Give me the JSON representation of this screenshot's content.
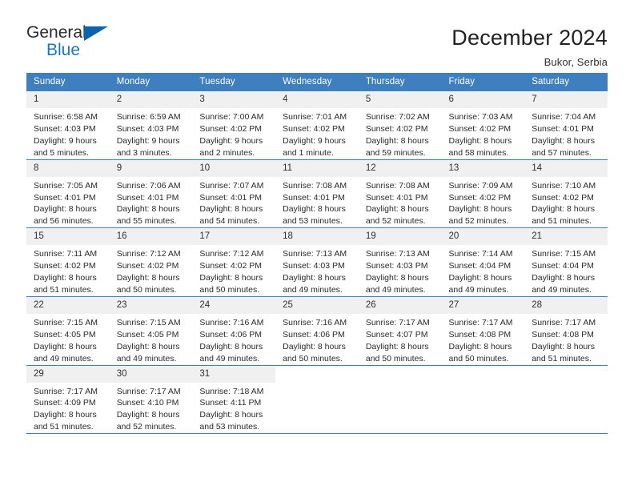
{
  "brand": {
    "name_part1": "General",
    "name_part2": "Blue",
    "triangle_color": "#0a63ad",
    "blue_color": "#1b76bc"
  },
  "header": {
    "title": "December 2024",
    "subtitle": "Bukor, Serbia"
  },
  "theme": {
    "header_bg": "#3d7fbf",
    "header_text": "#ffffff",
    "daynum_bg": "#f0f0f0",
    "cell_bg": "#ffffff",
    "grid_line": "#3d7fbf"
  },
  "weekdays": [
    "Sunday",
    "Monday",
    "Tuesday",
    "Wednesday",
    "Thursday",
    "Friday",
    "Saturday"
  ],
  "weeks": [
    [
      {
        "day": "1",
        "sunrise": "Sunrise: 6:58 AM",
        "sunset": "Sunset: 4:03 PM",
        "daylight1": "Daylight: 9 hours",
        "daylight2": "and 5 minutes."
      },
      {
        "day": "2",
        "sunrise": "Sunrise: 6:59 AM",
        "sunset": "Sunset: 4:03 PM",
        "daylight1": "Daylight: 9 hours",
        "daylight2": "and 3 minutes."
      },
      {
        "day": "3",
        "sunrise": "Sunrise: 7:00 AM",
        "sunset": "Sunset: 4:02 PM",
        "daylight1": "Daylight: 9 hours",
        "daylight2": "and 2 minutes."
      },
      {
        "day": "4",
        "sunrise": "Sunrise: 7:01 AM",
        "sunset": "Sunset: 4:02 PM",
        "daylight1": "Daylight: 9 hours",
        "daylight2": "and 1 minute."
      },
      {
        "day": "5",
        "sunrise": "Sunrise: 7:02 AM",
        "sunset": "Sunset: 4:02 PM",
        "daylight1": "Daylight: 8 hours",
        "daylight2": "and 59 minutes."
      },
      {
        "day": "6",
        "sunrise": "Sunrise: 7:03 AM",
        "sunset": "Sunset: 4:02 PM",
        "daylight1": "Daylight: 8 hours",
        "daylight2": "and 58 minutes."
      },
      {
        "day": "7",
        "sunrise": "Sunrise: 7:04 AM",
        "sunset": "Sunset: 4:01 PM",
        "daylight1": "Daylight: 8 hours",
        "daylight2": "and 57 minutes."
      }
    ],
    [
      {
        "day": "8",
        "sunrise": "Sunrise: 7:05 AM",
        "sunset": "Sunset: 4:01 PM",
        "daylight1": "Daylight: 8 hours",
        "daylight2": "and 56 minutes."
      },
      {
        "day": "9",
        "sunrise": "Sunrise: 7:06 AM",
        "sunset": "Sunset: 4:01 PM",
        "daylight1": "Daylight: 8 hours",
        "daylight2": "and 55 minutes."
      },
      {
        "day": "10",
        "sunrise": "Sunrise: 7:07 AM",
        "sunset": "Sunset: 4:01 PM",
        "daylight1": "Daylight: 8 hours",
        "daylight2": "and 54 minutes."
      },
      {
        "day": "11",
        "sunrise": "Sunrise: 7:08 AM",
        "sunset": "Sunset: 4:01 PM",
        "daylight1": "Daylight: 8 hours",
        "daylight2": "and 53 minutes."
      },
      {
        "day": "12",
        "sunrise": "Sunrise: 7:08 AM",
        "sunset": "Sunset: 4:01 PM",
        "daylight1": "Daylight: 8 hours",
        "daylight2": "and 52 minutes."
      },
      {
        "day": "13",
        "sunrise": "Sunrise: 7:09 AM",
        "sunset": "Sunset: 4:02 PM",
        "daylight1": "Daylight: 8 hours",
        "daylight2": "and 52 minutes."
      },
      {
        "day": "14",
        "sunrise": "Sunrise: 7:10 AM",
        "sunset": "Sunset: 4:02 PM",
        "daylight1": "Daylight: 8 hours",
        "daylight2": "and 51 minutes."
      }
    ],
    [
      {
        "day": "15",
        "sunrise": "Sunrise: 7:11 AM",
        "sunset": "Sunset: 4:02 PM",
        "daylight1": "Daylight: 8 hours",
        "daylight2": "and 51 minutes."
      },
      {
        "day": "16",
        "sunrise": "Sunrise: 7:12 AM",
        "sunset": "Sunset: 4:02 PM",
        "daylight1": "Daylight: 8 hours",
        "daylight2": "and 50 minutes."
      },
      {
        "day": "17",
        "sunrise": "Sunrise: 7:12 AM",
        "sunset": "Sunset: 4:02 PM",
        "daylight1": "Daylight: 8 hours",
        "daylight2": "and 50 minutes."
      },
      {
        "day": "18",
        "sunrise": "Sunrise: 7:13 AM",
        "sunset": "Sunset: 4:03 PM",
        "daylight1": "Daylight: 8 hours",
        "daylight2": "and 49 minutes."
      },
      {
        "day": "19",
        "sunrise": "Sunrise: 7:13 AM",
        "sunset": "Sunset: 4:03 PM",
        "daylight1": "Daylight: 8 hours",
        "daylight2": "and 49 minutes."
      },
      {
        "day": "20",
        "sunrise": "Sunrise: 7:14 AM",
        "sunset": "Sunset: 4:04 PM",
        "daylight1": "Daylight: 8 hours",
        "daylight2": "and 49 minutes."
      },
      {
        "day": "21",
        "sunrise": "Sunrise: 7:15 AM",
        "sunset": "Sunset: 4:04 PM",
        "daylight1": "Daylight: 8 hours",
        "daylight2": "and 49 minutes."
      }
    ],
    [
      {
        "day": "22",
        "sunrise": "Sunrise: 7:15 AM",
        "sunset": "Sunset: 4:05 PM",
        "daylight1": "Daylight: 8 hours",
        "daylight2": "and 49 minutes."
      },
      {
        "day": "23",
        "sunrise": "Sunrise: 7:15 AM",
        "sunset": "Sunset: 4:05 PM",
        "daylight1": "Daylight: 8 hours",
        "daylight2": "and 49 minutes."
      },
      {
        "day": "24",
        "sunrise": "Sunrise: 7:16 AM",
        "sunset": "Sunset: 4:06 PM",
        "daylight1": "Daylight: 8 hours",
        "daylight2": "and 49 minutes."
      },
      {
        "day": "25",
        "sunrise": "Sunrise: 7:16 AM",
        "sunset": "Sunset: 4:06 PM",
        "daylight1": "Daylight: 8 hours",
        "daylight2": "and 50 minutes."
      },
      {
        "day": "26",
        "sunrise": "Sunrise: 7:17 AM",
        "sunset": "Sunset: 4:07 PM",
        "daylight1": "Daylight: 8 hours",
        "daylight2": "and 50 minutes."
      },
      {
        "day": "27",
        "sunrise": "Sunrise: 7:17 AM",
        "sunset": "Sunset: 4:08 PM",
        "daylight1": "Daylight: 8 hours",
        "daylight2": "and 50 minutes."
      },
      {
        "day": "28",
        "sunrise": "Sunrise: 7:17 AM",
        "sunset": "Sunset: 4:08 PM",
        "daylight1": "Daylight: 8 hours",
        "daylight2": "and 51 minutes."
      }
    ],
    [
      {
        "day": "29",
        "sunrise": "Sunrise: 7:17 AM",
        "sunset": "Sunset: 4:09 PM",
        "daylight1": "Daylight: 8 hours",
        "daylight2": "and 51 minutes."
      },
      {
        "day": "30",
        "sunrise": "Sunrise: 7:17 AM",
        "sunset": "Sunset: 4:10 PM",
        "daylight1": "Daylight: 8 hours",
        "daylight2": "and 52 minutes."
      },
      {
        "day": "31",
        "sunrise": "Sunrise: 7:18 AM",
        "sunset": "Sunset: 4:11 PM",
        "daylight1": "Daylight: 8 hours",
        "daylight2": "and 53 minutes."
      },
      {
        "day": "",
        "sunrise": "",
        "sunset": "",
        "daylight1": "",
        "daylight2": ""
      },
      {
        "day": "",
        "sunrise": "",
        "sunset": "",
        "daylight1": "",
        "daylight2": ""
      },
      {
        "day": "",
        "sunrise": "",
        "sunset": "",
        "daylight1": "",
        "daylight2": ""
      },
      {
        "day": "",
        "sunrise": "",
        "sunset": "",
        "daylight1": "",
        "daylight2": ""
      }
    ]
  ]
}
